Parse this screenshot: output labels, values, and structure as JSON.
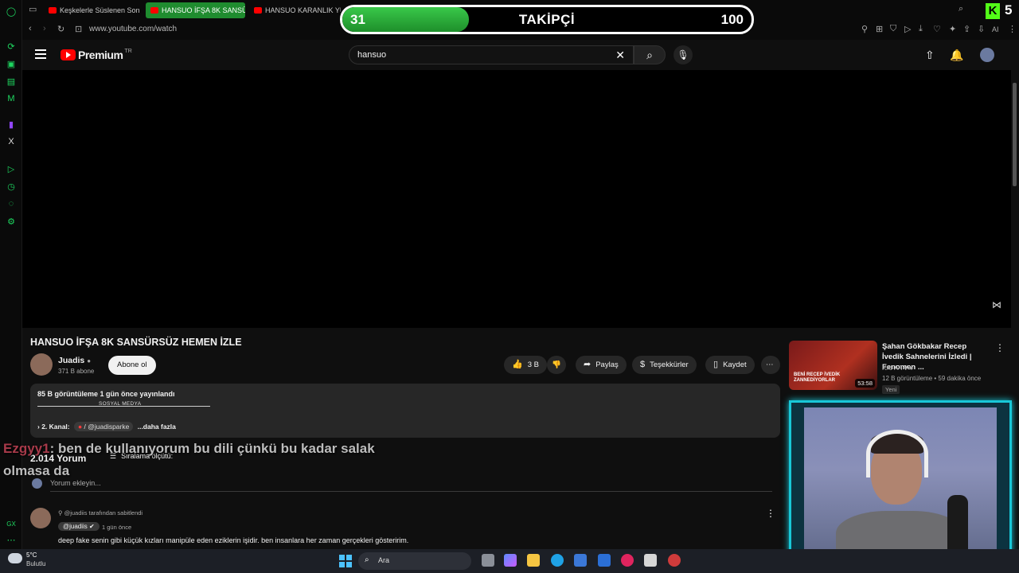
{
  "browser": {
    "tabs": [
      {
        "label": "Keşkelerle Süslenen Sonb"
      },
      {
        "label": "HANSUO İFŞA 8K SANSÜ"
      },
      {
        "label": "HANSUO KARANLIK YÜZ"
      }
    ],
    "url": "www.youtube.com/watch"
  },
  "youtube": {
    "brand": "Premium",
    "country": "TR",
    "search_value": "hansuo"
  },
  "video": {
    "title": "HANSUO İFŞA 8K SANSÜRSÜZ HEMEN İZLE",
    "channel": "Juadis",
    "subscribers": "371 B abone",
    "subscribe_label": "Abone ol",
    "likes": "3 B",
    "share_label": "Paylaş",
    "thanks_label": "Teşekkürler",
    "save_label": "Kaydet"
  },
  "description": {
    "meta": "85 B görüntüleme  1 gün önce yayınlandı",
    "social_heading": "SOSYAL MEDYA",
    "channel2_prefix": "› 2. Kanal:",
    "channel2_handle": "/ @juadisparke",
    "more_label": "...daha fazla"
  },
  "comments": {
    "count": "2.014 Yorum",
    "sort_label": "Sıralama ölçütü:",
    "add_placeholder": "Yorum ekleyin...",
    "pinned_by": "@juadiis tarafından sabitlendi",
    "author": "@juadiis",
    "time": "1 gün önce",
    "text": "deep fake senin gibi küçük kızları manipüle eden eziklerin işidir. ben insanlara her zaman gerçekleri gösteririm."
  },
  "stream_chat": {
    "user": "Ezgyy1",
    "message": ": ben de kullanıyorum bu dili çünkü bu kadar salak olmasa da"
  },
  "recommended": {
    "title": "Şahan Gökbakar Recep İvedik Sahnelerini İzledi | Fenomen ...",
    "channel": "KAFA TV",
    "meta": "12 B görüntüleme • 59 dakika önce",
    "badge": "Yeni",
    "duration": "53:58",
    "thumb_text": "BENİ RECEP İVEDİK ZANNEDİYORLAR"
  },
  "follower_goal": {
    "current": "31",
    "label": "TAKİPÇİ",
    "target": "100",
    "progress": 0.31
  },
  "kick": {
    "logo": "K",
    "count": "5"
  },
  "taskbar": {
    "temp": "5°C",
    "weather": "Bulutlu",
    "search_label": "Ara"
  },
  "colors": {
    "goal_green": "#2db53d",
    "webcam_frame": "#18c8d8",
    "kick_green": "#53fc18",
    "youtube_red": "#ff0000"
  }
}
